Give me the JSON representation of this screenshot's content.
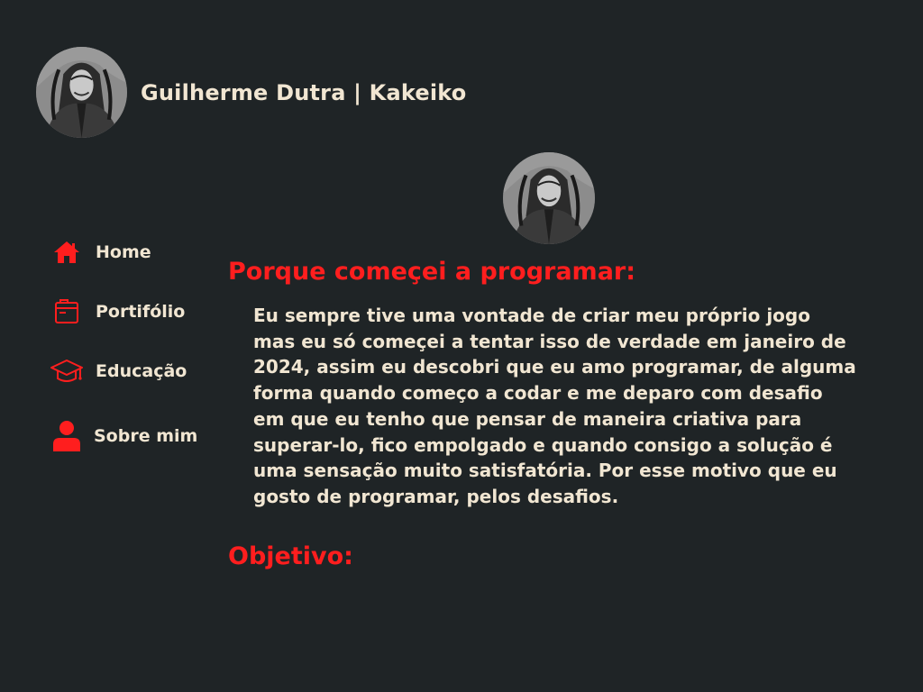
{
  "header": {
    "title": "Guilherme Dutra | Kakeiko"
  },
  "colors": {
    "background": "#1f2426",
    "accent": "#ff1e1e",
    "text": "#f1e6d2"
  },
  "sidebar": {
    "items": [
      {
        "label": "Home",
        "icon": "home-icon"
      },
      {
        "label": "Portifólio",
        "icon": "folder-icon"
      },
      {
        "label": "Educação",
        "icon": "graduation-cap-icon"
      },
      {
        "label": "Sobre mim",
        "icon": "user-icon"
      }
    ]
  },
  "main": {
    "sections": [
      {
        "title": "Porque começei a programar:",
        "text": "Eu sempre tive uma vontade de criar meu próprio jogo mas eu só começei a tentar isso de verdade em janeiro de 2024, assim eu descobri que eu amo programar, de alguma forma quando começo a codar e me deparo com desafio em que eu tenho que pensar de maneira criativa para superar-lo, fico empolgado e quando consigo a solução é uma sensação muito satisfatória. Por esse motivo que eu gosto de programar, pelos desafios."
      },
      {
        "title": "Objetivo:"
      }
    ]
  }
}
